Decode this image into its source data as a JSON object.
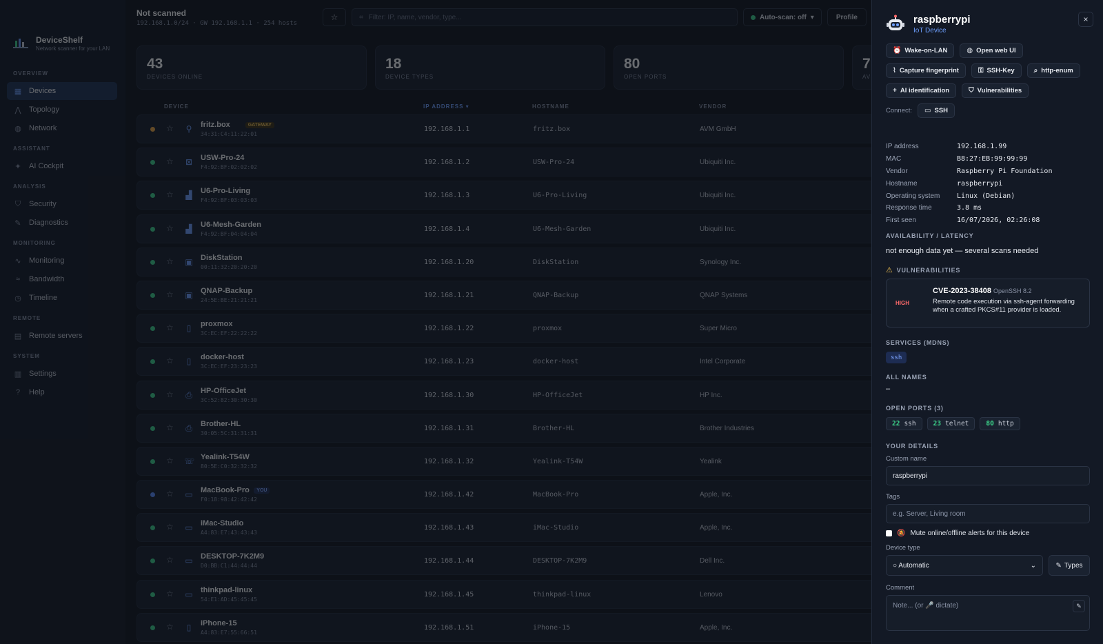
{
  "brand": {
    "name": "DeviceShelf",
    "tagline": "Network scanner for your LAN"
  },
  "sidebar": {
    "sections": [
      {
        "label": "OVERVIEW",
        "items": [
          {
            "label": "Devices",
            "icon": "grid-icon",
            "active": true
          },
          {
            "label": "Topology",
            "icon": "topology-icon"
          },
          {
            "label": "Network",
            "icon": "globe-icon"
          }
        ]
      },
      {
        "label": "ASSISTANT",
        "items": [
          {
            "label": "AI Cockpit",
            "icon": "sparkle-icon"
          }
        ]
      },
      {
        "label": "ANALYSIS",
        "items": [
          {
            "label": "Security",
            "icon": "shield-icon"
          },
          {
            "label": "Diagnostics",
            "icon": "wrench-icon"
          }
        ]
      },
      {
        "label": "MONITORING",
        "items": [
          {
            "label": "Monitoring",
            "icon": "pulse-icon"
          },
          {
            "label": "Bandwidth",
            "icon": "bandwidth-icon"
          },
          {
            "label": "Timeline",
            "icon": "clock-icon"
          }
        ]
      },
      {
        "label": "REMOTE",
        "items": [
          {
            "label": "Remote servers",
            "icon": "server-icon"
          }
        ]
      },
      {
        "label": "SYSTEM",
        "items": [
          {
            "label": "Settings",
            "icon": "settings-icon"
          },
          {
            "label": "Help",
            "icon": "help-icon"
          }
        ]
      }
    ]
  },
  "topbar": {
    "status_title": "Not scanned",
    "status_meta": "192.168.1.0/24 · GW 192.168.1.1 · 254 hosts",
    "filter_placeholder": "Filter: IP, name, vendor, type...",
    "autoscan_label": "Auto-scan: off",
    "profile_label": "Profile"
  },
  "stats": [
    {
      "value": "43",
      "label": "DEVICES ONLINE"
    },
    {
      "value": "18",
      "label": "DEVICE TYPES"
    },
    {
      "value": "80",
      "label": "OPEN PORTS"
    },
    {
      "value": "7",
      "label": "AV"
    }
  ],
  "table": {
    "headers": {
      "device": "DEVICE",
      "ip": "IP ADDRESS ▾",
      "hostname": "HOSTNAME",
      "vendor": "VENDOR"
    },
    "rows": [
      {
        "name": "fritz.box",
        "mac": "34:31:C4:11:22:01",
        "ip": "192.168.1.1",
        "hostname": "fritz.box",
        "vendor": "AVM GmbH",
        "status": "orange",
        "icon": "router-icon",
        "glyph": "⚲",
        "badge": "GATEWAY"
      },
      {
        "name": "USW-Pro-24",
        "mac": "F4:92:BF:02:02:02",
        "ip": "192.168.1.2",
        "hostname": "USW-Pro-24",
        "vendor": "Ubiquiti Inc.",
        "status": "green",
        "icon": "switch-icon",
        "glyph": "⊠"
      },
      {
        "name": "U6-Pro-Living",
        "mac": "F4:92:BF:03:03:03",
        "ip": "192.168.1.3",
        "hostname": "U6-Pro-Living",
        "vendor": "Ubiquiti Inc.",
        "status": "green",
        "icon": "access-point-icon",
        "glyph": "▟"
      },
      {
        "name": "U6-Mesh-Garden",
        "mac": "F4:92:BF:04:04:04",
        "ip": "192.168.1.4",
        "hostname": "U6-Mesh-Garden",
        "vendor": "Ubiquiti Inc.",
        "status": "green",
        "icon": "access-point-icon",
        "glyph": "▟"
      },
      {
        "name": "DiskStation",
        "mac": "00:11:32:20:20:20",
        "ip": "192.168.1.20",
        "hostname": "DiskStation",
        "vendor": "Synology Inc.",
        "status": "green",
        "icon": "nas-icon",
        "glyph": "▣"
      },
      {
        "name": "QNAP-Backup",
        "mac": "24:5E:BE:21:21:21",
        "ip": "192.168.1.21",
        "hostname": "QNAP-Backup",
        "vendor": "QNAP Systems",
        "status": "green",
        "icon": "nas-icon",
        "glyph": "▣"
      },
      {
        "name": "proxmox",
        "mac": "3C:EC:EF:22:22:22",
        "ip": "192.168.1.22",
        "hostname": "proxmox",
        "vendor": "Super Micro",
        "status": "green",
        "icon": "server-icon",
        "glyph": "▯"
      },
      {
        "name": "docker-host",
        "mac": "3C:EC:EF:23:23:23",
        "ip": "192.168.1.23",
        "hostname": "docker-host",
        "vendor": "Intel Corporate",
        "status": "green",
        "icon": "server-icon",
        "glyph": "▯"
      },
      {
        "name": "HP-OfficeJet",
        "mac": "3C:52:82:30:30:30",
        "ip": "192.168.1.30",
        "hostname": "HP-OfficeJet",
        "vendor": "HP Inc.",
        "status": "green",
        "icon": "printer-icon",
        "glyph": "⎙"
      },
      {
        "name": "Brother-HL",
        "mac": "30:05:5C:31:31:31",
        "ip": "192.168.1.31",
        "hostname": "Brother-HL",
        "vendor": "Brother Industries",
        "status": "green",
        "icon": "printer-icon",
        "glyph": "⎙"
      },
      {
        "name": "Yealink-T54W",
        "mac": "80:5E:C0:32:32:32",
        "ip": "192.168.1.32",
        "hostname": "Yealink-T54W",
        "vendor": "Yealink",
        "status": "green",
        "icon": "phone-icon",
        "glyph": "☏"
      },
      {
        "name": "MacBook-Pro",
        "mac": "F0:18:98:42:42:42",
        "ip": "192.168.1.42",
        "hostname": "MacBook-Pro",
        "vendor": "Apple, Inc.",
        "status": "blue",
        "icon": "laptop-icon",
        "glyph": "▭",
        "badge": "YOU"
      },
      {
        "name": "iMac-Studio",
        "mac": "A4:83:E7:43:43:43",
        "ip": "192.168.1.43",
        "hostname": "iMac-Studio",
        "vendor": "Apple, Inc.",
        "status": "green",
        "icon": "desktop-icon",
        "glyph": "▭"
      },
      {
        "name": "DESKTOP-7K2M9",
        "mac": "D0:BB:C1:44:44:44",
        "ip": "192.168.1.44",
        "hostname": "DESKTOP-7K2M9",
        "vendor": "Dell Inc.",
        "status": "green",
        "icon": "desktop-icon",
        "glyph": "▭"
      },
      {
        "name": "thinkpad-linux",
        "mac": "54:E1:AD:45:45:45",
        "ip": "192.168.1.45",
        "hostname": "thinkpad-linux",
        "vendor": "Lenovo",
        "status": "green",
        "icon": "laptop-icon",
        "glyph": "▭"
      },
      {
        "name": "iPhone-15",
        "mac": "A4:83:E7:55:66:51",
        "ip": "192.168.1.51",
        "hostname": "iPhone-15",
        "vendor": "Apple, Inc.",
        "status": "green",
        "icon": "phone-icon",
        "glyph": "▯"
      }
    ]
  },
  "panel": {
    "title": "raspberrypi",
    "subtitle": "IoT Device",
    "close_label": "×",
    "actions": [
      {
        "label": "Wake-on-LAN",
        "icon": "alarm-icon",
        "glyph": "⏰"
      },
      {
        "label": "Open web UI",
        "icon": "globe-icon",
        "glyph": "◍"
      },
      {
        "label": "Capture fingerprint",
        "icon": "fingerprint-icon",
        "glyph": "⌇"
      },
      {
        "label": "SSH-Key",
        "icon": "key-icon",
        "glyph": "⚿"
      },
      {
        "label": "http-enum",
        "icon": "magnifier-icon",
        "glyph": "⌕"
      },
      {
        "label": "AI identification",
        "icon": "sparkle-icon",
        "glyph": "+"
      },
      {
        "label": "Vulnerabilities",
        "icon": "shield-icon",
        "glyph": "⛉"
      }
    ],
    "connect_label": "Connect:",
    "connect_ssh": "SSH",
    "details": [
      {
        "k": "IP address",
        "v": "192.168.1.99"
      },
      {
        "k": "MAC",
        "v": "B8:27:EB:99:99:99"
      },
      {
        "k": "Vendor",
        "v": "Raspberry Pi Foundation"
      },
      {
        "k": "Hostname",
        "v": "raspberrypi"
      },
      {
        "k": "Operating system",
        "v": "Linux (Debian)"
      },
      {
        "k": "Response time",
        "v": "3.8 ms"
      },
      {
        "k": "First seen",
        "v": "16/07/2026, 02:26:08"
      }
    ],
    "availability_label": "AVAILABILITY / LATENCY",
    "availability_text": "not enough data yet — several scans needed",
    "vuln_label": "VULNERABILITIES",
    "vuln": {
      "severity": "HIGH",
      "id": "CVE-2023-38408",
      "product": "OpenSSH 8.2",
      "desc": "Remote code execution via ssh-agent forwarding when a crafted PKCS#11 provider is loaded."
    },
    "services_label": "SERVICES (MDNS)",
    "services": [
      "ssh"
    ],
    "all_names_label": "ALL NAMES",
    "all_names_value": "–",
    "ports_label": "OPEN PORTS (3)",
    "ports": [
      {
        "num": "22",
        "name": "ssh"
      },
      {
        "num": "23",
        "name": "telnet"
      },
      {
        "num": "80",
        "name": "http"
      }
    ],
    "your_details_label": "YOUR DETAILS",
    "custom_name_label": "Custom name",
    "custom_name_value": "raspberrypi",
    "tags_label": "Tags",
    "tags_placeholder": "e.g. Server, Living room",
    "mute_label": "Mute online/offline alerts for this device",
    "device_type_label": "Device type",
    "device_type_value": "○ Automatic",
    "types_button": "Types",
    "comment_label": "Comment",
    "comment_placeholder": "Note... (or 🎤 dictate)"
  },
  "colors": {
    "accent": "#6ea0ff",
    "online": "#3dd68c",
    "gateway": "#f0a640",
    "self": "#5b8cff",
    "high": "#ff6b6b"
  }
}
